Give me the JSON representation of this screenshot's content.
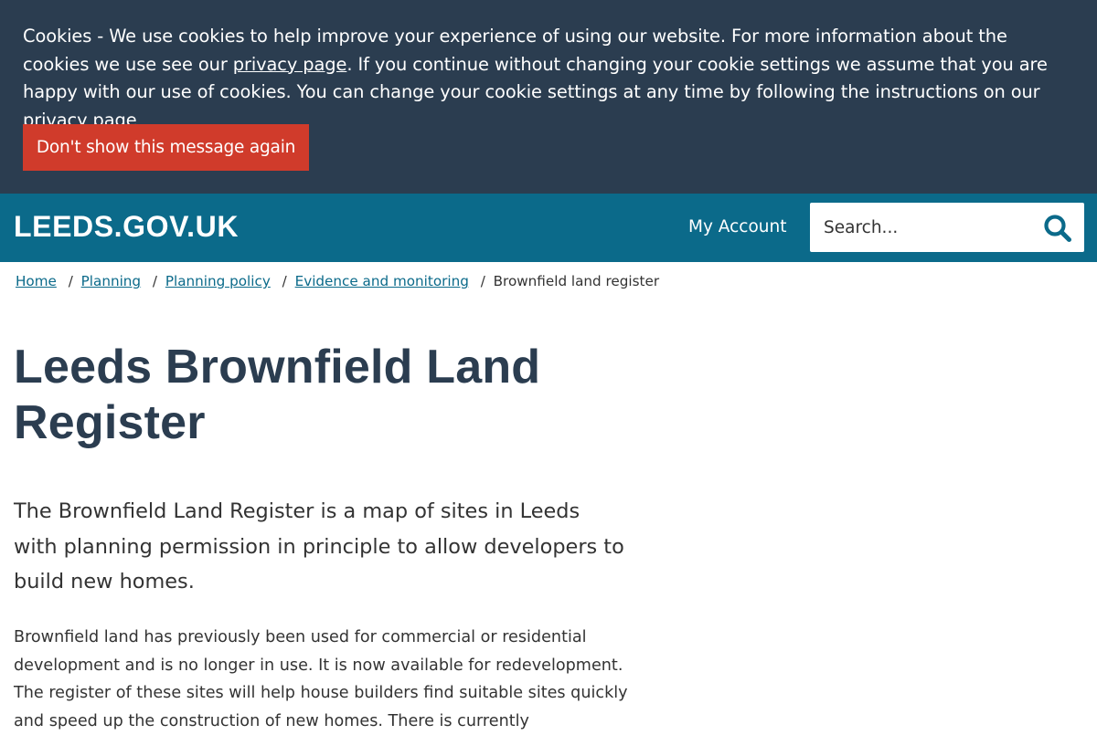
{
  "cookie_banner": {
    "text_before_link": "Cookies - We use cookies to help improve your experience of using our website. For more information about the cookies we use see our ",
    "link1": "privacy page",
    "text_middle": ". If you continue without changing your cookie settings we assume that you are happy with our use of cookies. You can change your cookie settings at any time by following the instructions on our ",
    "link2": "privacy page",
    "button_label": "Don't show this message again",
    "background_color": "#2b3d50",
    "button_color": "#d03b2b"
  },
  "header": {
    "logo": "LEEDS.GOV.UK",
    "my_account": "My Account",
    "search_placeholder": "Search...",
    "search_icon": "search-icon",
    "background_color": "#0b6a8a"
  },
  "breadcrumb": {
    "items": [
      "Home",
      "Planning",
      "Planning policy",
      "Evidence and monitoring"
    ],
    "separator": "/",
    "current": "Brownfield land register"
  },
  "main": {
    "title": "Leeds Brownfield Land Register",
    "lead": "The Brownfield Land Register is a map of sites in Leeds with planning permission in principle to allow developers to build new homes.",
    "body": "Brownfield land has previously been used for commercial or residential development and is no longer in use. It is now available for redevelopment. The register of these sites will help house builders find suitable sites quickly and speed up the construction of new homes. There is currently"
  }
}
